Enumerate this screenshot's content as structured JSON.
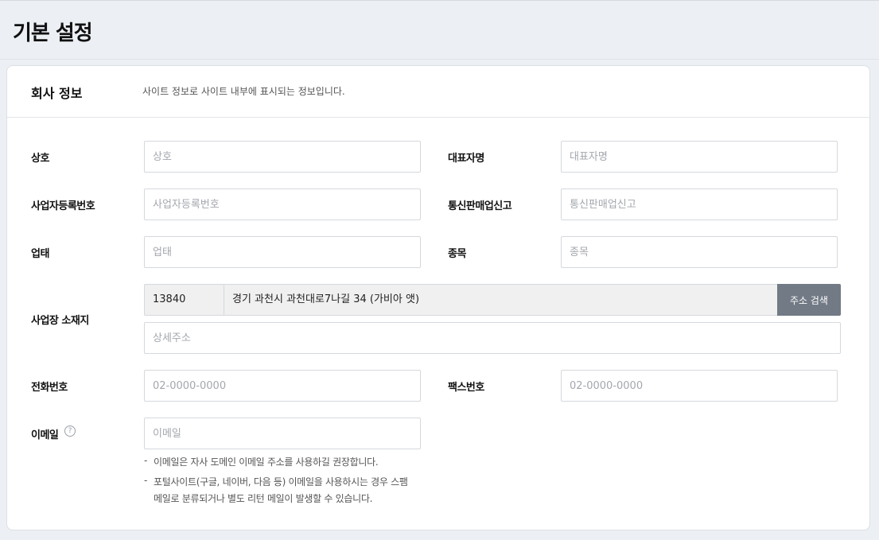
{
  "page": {
    "title": "기본 설정"
  },
  "section": {
    "title": "회사 정보",
    "description": "사이트 정보로 사이트 내부에 표시되는 정보입니다."
  },
  "fields": {
    "company_name": {
      "label": "상호",
      "placeholder": "상호",
      "value": ""
    },
    "ceo_name": {
      "label": "대표자명",
      "placeholder": "대표자명",
      "value": ""
    },
    "business_reg_no": {
      "label": "사업자등록번호",
      "placeholder": "사업자등록번호",
      "value": ""
    },
    "mail_order_reg": {
      "label": "통신판매업신고",
      "placeholder": "통신판매업신고",
      "value": ""
    },
    "business_type": {
      "label": "업태",
      "placeholder": "업태",
      "value": ""
    },
    "business_item": {
      "label": "종목",
      "placeholder": "종목",
      "value": ""
    },
    "address": {
      "label": "사업장 소재지",
      "zipcode": "13840",
      "address_line": "경기 과천시 과천대로7나길 34 (가비아 앳)",
      "search_button": "주소 검색",
      "detail_placeholder": "상세주소",
      "detail_value": ""
    },
    "phone": {
      "label": "전화번호",
      "placeholder": "02-0000-0000",
      "value": ""
    },
    "fax": {
      "label": "팩스번호",
      "placeholder": "02-0000-0000",
      "value": ""
    },
    "email": {
      "label": "이메일",
      "help_icon": "question-circle-icon",
      "help_glyph": "?",
      "placeholder": "이메일",
      "value": "",
      "note_bullet": "-",
      "notes": [
        "이메일은 자사 도메인 이메일 주소를 사용하길 권장합니다.",
        "포털사이트(구글, 네이버, 다음 등) 이메일을 사용하시는 경우 스팸",
        "메일로 분류되거나 별도 리턴 메일이 발생할 수 있습니다."
      ]
    }
  }
}
